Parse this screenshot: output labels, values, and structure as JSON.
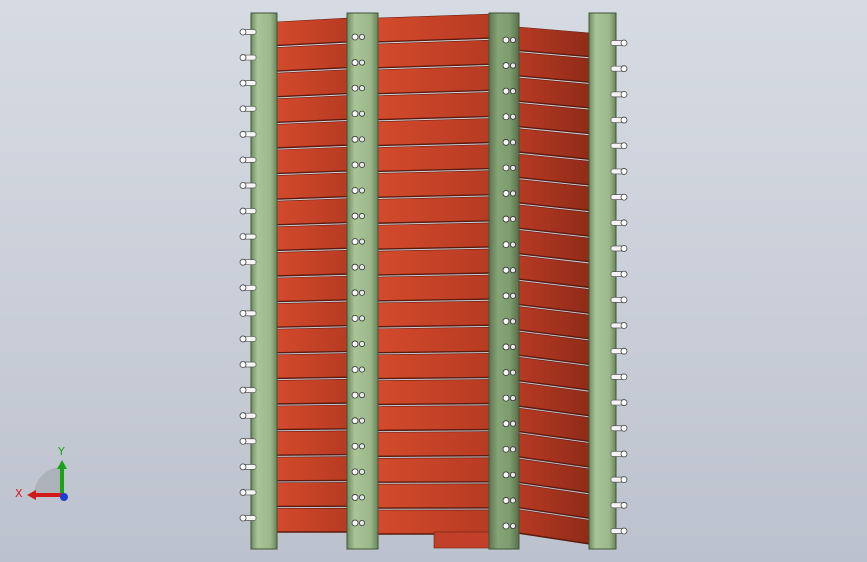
{
  "viewport": {
    "background_top": "#d6dbe3",
    "background_bottom": "#bcc2cd"
  },
  "model": {
    "part": "finned-heat-exchanger-assembly",
    "plate_color": "#9bb88a",
    "plate_dark_color": "#7a9a6c",
    "fin_color": "#c8452a",
    "fin_dark_color": "#8e2a1a",
    "fin_rows": 20,
    "plate_count": 4,
    "bolt_color": "#f0f0f0"
  },
  "triad": {
    "x_label": "X",
    "y_label": "Y",
    "x_color": "#d11a1a",
    "y_color": "#1aa31a",
    "z_color": "#1a3fd1"
  }
}
